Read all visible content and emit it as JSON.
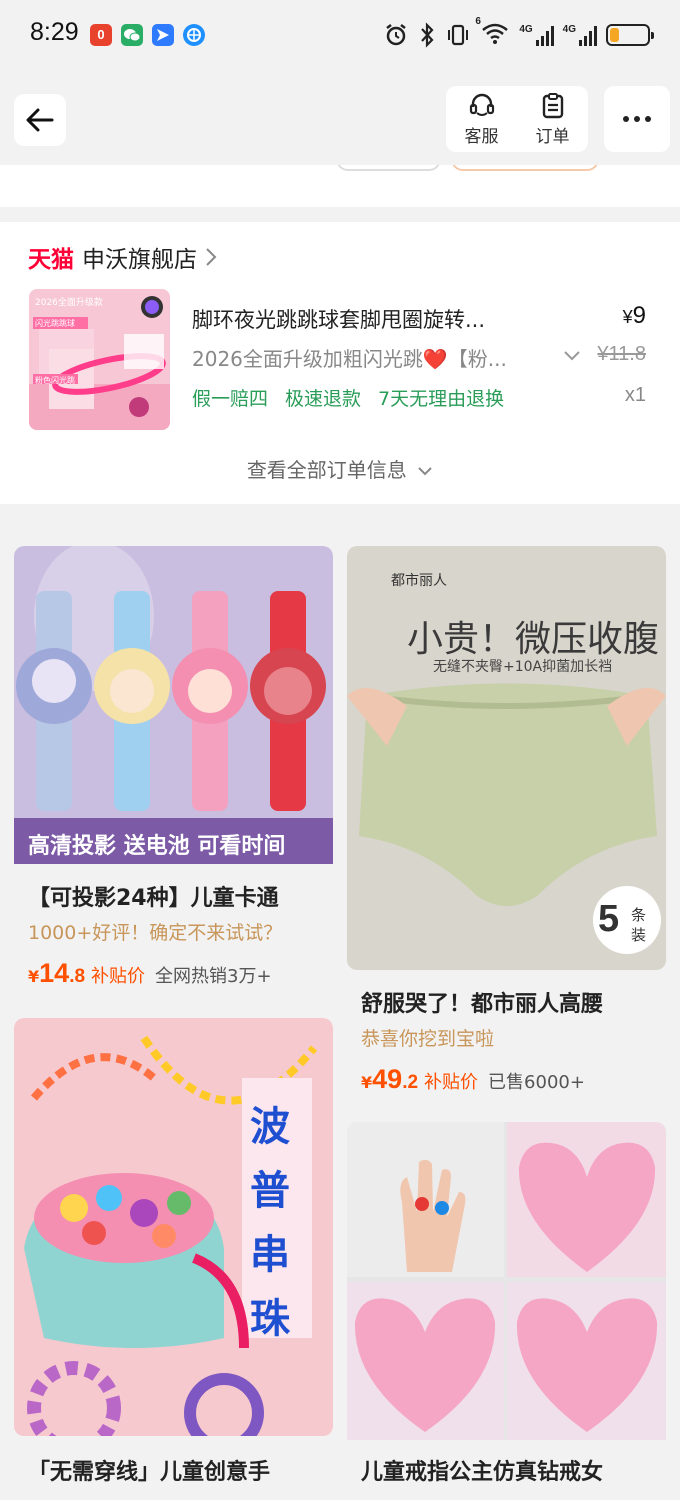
{
  "status_bar": {
    "time": "8:29",
    "net1": "4G",
    "net2": "4G",
    "wifi_label": "6",
    "battery_level": 0.25,
    "app_icons": [
      {
        "name": "red-app-icon",
        "glyph": "0",
        "color": "#e8412c"
      },
      {
        "name": "wechat-icon",
        "glyph": "",
        "color": "#2aae67"
      },
      {
        "name": "blue-app-icon",
        "glyph": "",
        "color": "#2f7bff"
      },
      {
        "name": "globe-app-icon",
        "glyph": "",
        "color": "#1e90ff"
      }
    ]
  },
  "header": {
    "service_label": "客服",
    "orders_label": "订单"
  },
  "order": {
    "tmall_label": "天猫",
    "store_name": "申沃旗舰店",
    "product_title": "脚环夜光跳跳球套脚甩圈旋转...",
    "price_symbol": "¥",
    "price": "9",
    "sku_text": "2026全面升级加粗闪光跳❤️【粉...",
    "original_price": "¥11.8",
    "tags": [
      "假一赔四",
      "极速退款",
      "7天无理由退换"
    ],
    "quantity": "x1",
    "view_all": "查看全部订单信息",
    "thumb_text": "2026全面升级款",
    "thumb_badge": "闪光跳跳球",
    "thumb_pink": "粉色闪光跳"
  },
  "feed": [
    {
      "title": "【可投影24种】儿童卡通",
      "subtitle": "1000+好评！确定不来试试？",
      "price_int": "14",
      "price_dec": ".8",
      "currency": "¥",
      "subsidy": "补贴价",
      "sold": "全网热销3万+",
      "banner": "高清投影 送电池 可看时间"
    },
    {
      "title": "舒服哭了！都市丽人高腰",
      "subtitle": "恭喜你挖到宝啦",
      "price_int": "49",
      "price_dec": ".2",
      "currency": "¥",
      "subsidy": "补贴价",
      "sold": "已售6000+",
      "brand": "都市丽人",
      "headline": "小贵！微压收腹",
      "tagline": "无缝不夹臀+10A抑菌加长裆",
      "badge_num": "5",
      "badge_txt1": "条",
      "badge_txt2": "装"
    },
    {
      "title": "「无需穿线」儿童创意手",
      "vertical": [
        "波",
        "普",
        "串",
        "珠"
      ]
    },
    {
      "title": "儿童戒指公主仿真钻戒女"
    }
  ]
}
